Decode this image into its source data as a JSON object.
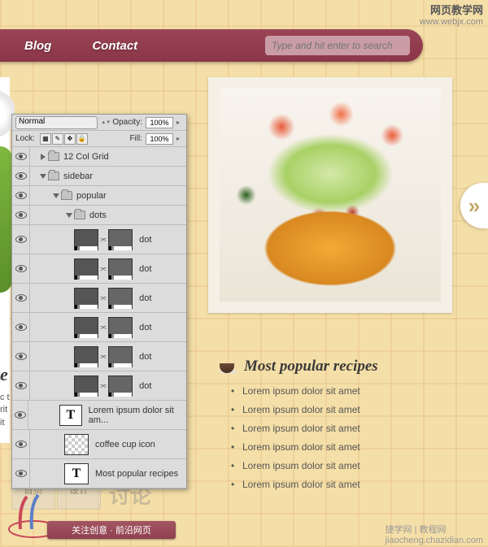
{
  "watermark": {
    "cn": "网页教学网",
    "url": "www.webjx.com",
    "br": "捷学网 | 教程网",
    "br2": "jiaocheng.chazidian.com"
  },
  "nav": {
    "blog": "Blog",
    "contact": "Contact"
  },
  "search": {
    "placeholder": "Type and hit enter to search"
  },
  "left": {
    "title_fragment": "e",
    "text_fragment": "c t rit it"
  },
  "popular": {
    "title": "Most popular recipes",
    "items": [
      "Lorem ipsum dolor sit amet",
      "Lorem ipsum dolor sit amet",
      "Lorem ipsum dolor sit amet",
      "Lorem ipsum dolor sit amet",
      "Lorem ipsum dolor sit amet",
      "Lorem ipsum dolor sit amet"
    ]
  },
  "arrow": "»",
  "panel": {
    "blend": "Normal",
    "opacity_label": "Opacity:",
    "opacity_value": "100%",
    "lock_label": "Lock:",
    "fill_label": "Fill:",
    "fill_value": "100%",
    "layers": {
      "grid": "12 Col Grid",
      "sidebar": "sidebar",
      "popular": "popular",
      "dots": "dots",
      "dot": "dot",
      "text_layer": "Lorem ipsum dolor sit am...",
      "coffee": "coffee cup icon",
      "title_layer": "Most popular recipes"
    }
  },
  "ribbon": "关注创意 · 前沿网页",
  "ghost": {
    "tab1": "首页",
    "tab2": "设计",
    "cn": "讨论"
  }
}
